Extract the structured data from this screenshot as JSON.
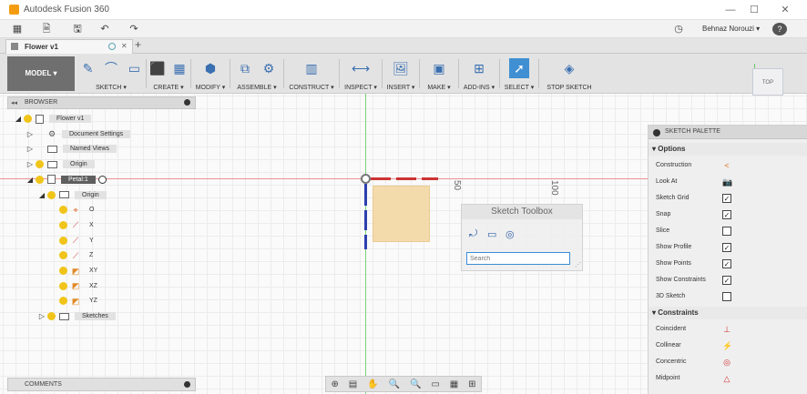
{
  "window": {
    "title": "Autodesk Fusion 360",
    "minimize": "—",
    "maximize": "☐",
    "close": "✕"
  },
  "qat": {
    "grid_icon": "▦",
    "file_icon": "🗎",
    "save_icon": "🖫",
    "undo_icon": "↶",
    "redo_icon": "↷",
    "clock_icon": "◷",
    "user": "Behnaz Norouzi ▾",
    "help_icon": "?"
  },
  "doc_tab": {
    "label": "Flower v1",
    "close_icon": "✕",
    "add_icon": "+"
  },
  "toolbar": {
    "model_label": "MODEL ▾",
    "groups": [
      {
        "label": "SKETCH ▾",
        "icons": [
          "✎",
          "⌒",
          "▭"
        ]
      },
      {
        "label": "CREATE ▾",
        "icons": [
          "⬛",
          "▦"
        ]
      },
      {
        "label": "MODIFY ▾",
        "icons": [
          "⬢"
        ]
      },
      {
        "label": "ASSEMBLE ▾",
        "icons": [
          "⧉",
          "⚙"
        ]
      },
      {
        "label": "CONSTRUCT ▾",
        "icons": [
          "▥"
        ]
      },
      {
        "label": "INSPECT ▾",
        "icons": [
          "⟷"
        ]
      },
      {
        "label": "INSERT ▾",
        "icons": [
          "🖼"
        ]
      },
      {
        "label": "MAKE ▾",
        "icons": [
          "▣"
        ]
      },
      {
        "label": "ADD-INS ▾",
        "icons": [
          "⊞"
        ]
      },
      {
        "label": "SELECT ▾",
        "icons": [
          "➚"
        ]
      },
      {
        "label": "STOP SKETCH",
        "icons": [
          "◈"
        ]
      }
    ]
  },
  "browser": {
    "title": "BROWSER",
    "collapse_icon": "◂◂",
    "items": [
      {
        "label": "Flower v1",
        "indent": 0,
        "tri": "◢",
        "icon": "doc",
        "bulb": true
      },
      {
        "label": "Document Settings",
        "indent": 1,
        "tri": "▷",
        "icon": "gear",
        "bulb": false
      },
      {
        "label": "Named Views",
        "indent": 1,
        "tri": "▷",
        "icon": "folder",
        "bulb": false
      },
      {
        "label": "Origin",
        "indent": 1,
        "tri": "▷",
        "icon": "folder",
        "bulb": true
      },
      {
        "label": "Petal:1",
        "indent": 1,
        "tri": "◢",
        "icon": "doc",
        "bulb": true,
        "selected": true
      },
      {
        "label": "Origin",
        "indent": 2,
        "tri": "◢",
        "icon": "folder",
        "bulb": true
      },
      {
        "label": "O",
        "indent": 3,
        "tri": "",
        "icon": "point",
        "bulb": true
      },
      {
        "label": "X",
        "indent": 3,
        "tri": "",
        "icon": "axis",
        "bulb": true
      },
      {
        "label": "Y",
        "indent": 3,
        "tri": "",
        "icon": "axis",
        "bulb": true
      },
      {
        "label": "Z",
        "indent": 3,
        "tri": "",
        "icon": "axis",
        "bulb": true
      },
      {
        "label": "XY",
        "indent": 3,
        "tri": "",
        "icon": "plane",
        "bulb": true
      },
      {
        "label": "XZ",
        "indent": 3,
        "tri": "",
        "icon": "plane",
        "bulb": true
      },
      {
        "label": "YZ",
        "indent": 3,
        "tri": "",
        "icon": "plane",
        "bulb": true
      },
      {
        "label": "Sketches",
        "indent": 2,
        "tri": "▷",
        "icon": "folder",
        "bulb": true
      }
    ]
  },
  "comments": {
    "title": "COMMENTS"
  },
  "canvas": {
    "ruler_50": "50",
    "ruler_100": "100"
  },
  "toolbox": {
    "title": "Sketch Toolbox",
    "search_placeholder": "Search"
  },
  "palette": {
    "title": "SKETCH PALETTE",
    "options_title": "▾ Options",
    "options": [
      {
        "label": "Construction",
        "control": "<",
        "type": "icon",
        "color": "#e07020"
      },
      {
        "label": "Look At",
        "control": "📷",
        "type": "icon",
        "color": "#555555"
      },
      {
        "label": "Sketch Grid",
        "control": "✓",
        "type": "check"
      },
      {
        "label": "Snap",
        "control": "✓",
        "type": "check"
      },
      {
        "label": "Slice",
        "control": "",
        "type": "check"
      },
      {
        "label": "Show Profile",
        "control": "✓",
        "type": "check"
      },
      {
        "label": "Show Points",
        "control": "✓",
        "type": "check"
      },
      {
        "label": "Show Constraints",
        "control": "✓",
        "type": "check"
      },
      {
        "label": "3D Sketch",
        "control": "",
        "type": "check"
      }
    ],
    "constraints_title": "▾ Constraints",
    "constraints": [
      {
        "label": "Coincident",
        "control": "⊥",
        "color": "#d03030"
      },
      {
        "label": "Collinear",
        "control": "⚡",
        "color": "#d03030"
      },
      {
        "label": "Concentric",
        "control": "◎",
        "color": "#d03030"
      },
      {
        "label": "Midpoint",
        "control": "△",
        "color": "#d03030"
      }
    ]
  },
  "viewcube": {
    "label": "TOP"
  },
  "navbar": {
    "icons": [
      "⊕",
      "▤",
      "✋",
      "🔍",
      "🔍",
      "▭",
      "▦",
      "⊞"
    ]
  },
  "colors": {
    "accent": "#3a8cd6",
    "sketch_profile": "#f4d9a6",
    "axis_green": "#7ad27a",
    "axis_red": "#ee9090"
  }
}
